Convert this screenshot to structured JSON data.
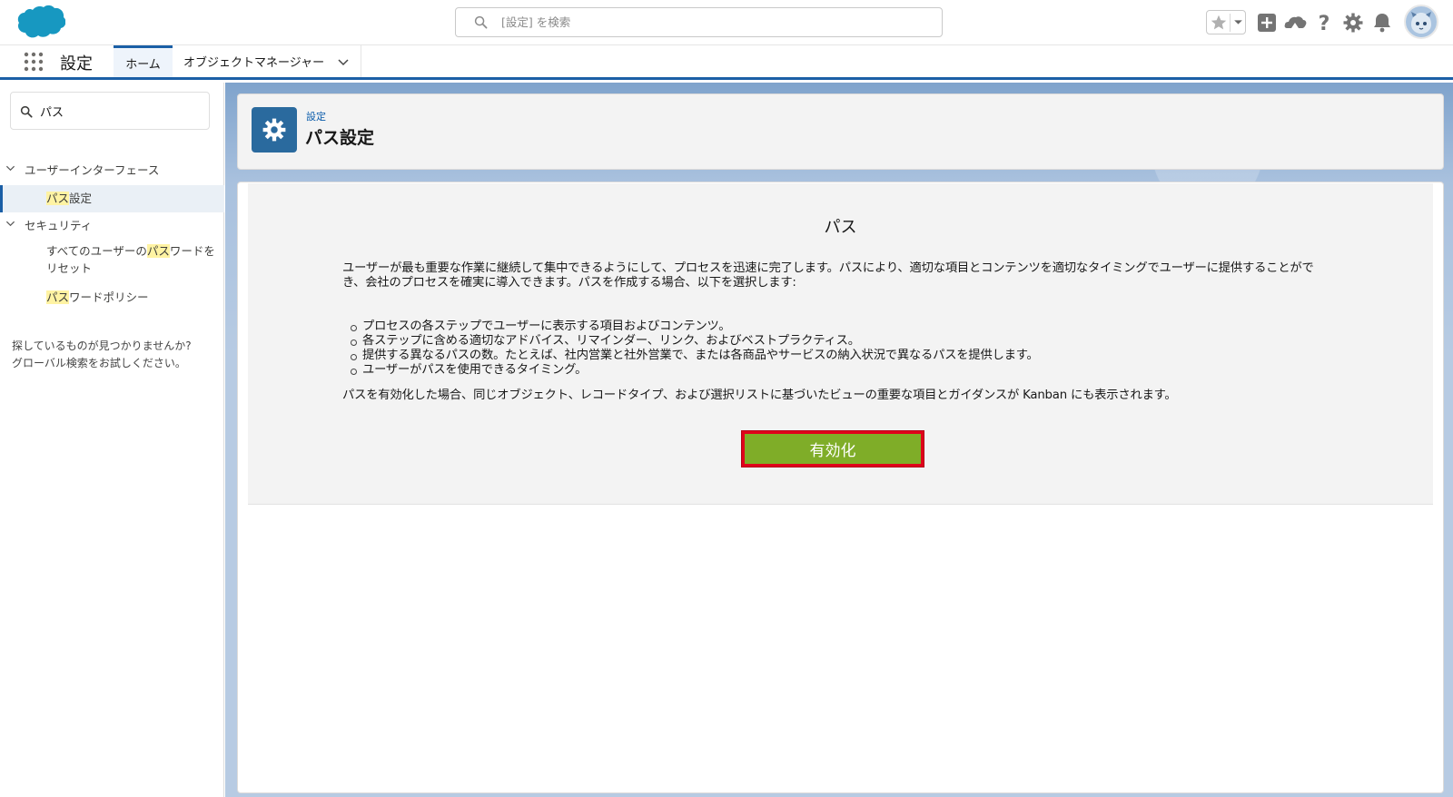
{
  "header": {
    "search_placeholder": "[設定] を検索",
    "icons": [
      "salesforce-cloud-logo",
      "search-icon",
      "star-icon",
      "chevron-down-icon",
      "plus-icon",
      "trailhead-icon",
      "help-icon",
      "gear-icon",
      "bell-icon",
      "avatar"
    ]
  },
  "app_nav": {
    "app_name": "設定",
    "tabs": [
      {
        "label": "ホーム",
        "active": true
      },
      {
        "label": "オブジェクトマネージャー",
        "active": false
      }
    ]
  },
  "sidebar": {
    "quick_find_value": "パス",
    "sections": [
      {
        "label": "ユーザーインターフェース",
        "items": [
          {
            "pre": "",
            "match": "パス",
            "post": "設定",
            "active": true
          }
        ]
      },
      {
        "label": "セキュリティ",
        "items": [
          {
            "pre": "すべてのユーザーの",
            "match": "パス",
            "post": "ワードを",
            "line2": "リセット",
            "active": false
          },
          {
            "pre": "",
            "match": "パス",
            "post": "ワードポリシー",
            "active": false
          }
        ]
      }
    ],
    "not_found_line1": "探しているものが見つかりませんか?",
    "not_found_line2": "グローバル検索をお試しください。"
  },
  "page_header": {
    "breadcrumb": "設定",
    "title": "パス設定"
  },
  "intro": {
    "title": "パス",
    "description": "ユーザーが最も重要な作業に継続して集中できるようにして、プロセスを迅速に完了します。パスにより、適切な項目とコンテンツを適切なタイミングでユーザーに提供することができ、会社のプロセスを確実に導入できます。パスを作成する場合、以下を選択します:",
    "bullets": [
      "プロセスの各ステップでユーザーに表示する項目およびコンテンツ。",
      "各ステップに含める適切なアドバイス、リマインダー、リンク、およびベストプラクティス。",
      "提供する異なるパスの数。たとえば、社内営業と社外営業で、または各商品やサービスの納入状況で異なるパスを提供します。",
      "ユーザーがパスを使用できるタイミング。"
    ],
    "kanban_note": "パスを有効化した場合、同じオブジェクト、レコードタイプ、および選択リストに基づいたビューの重要な項目とガイダンスが Kanban にも表示されます。",
    "enable_button": "有効化"
  },
  "colors": {
    "brand_blue": "#1b5fa6",
    "enable_green": "#7fad28",
    "highlight_box": "#e0001b",
    "search_highlight": "#fff3a3"
  }
}
